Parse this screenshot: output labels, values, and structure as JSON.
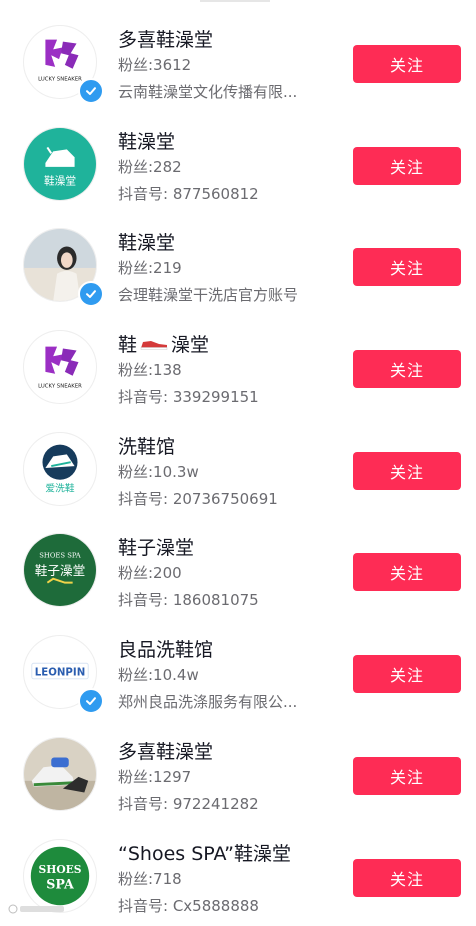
{
  "accounts": [
    {
      "name": "多喜鞋澡堂",
      "fans": "粉丝:3612",
      "sub": "云南鞋澡堂文化传播有限...",
      "verified": true,
      "avatar_text": "LUCKY SNEAKER",
      "follow": "关注"
    },
    {
      "name": "鞋澡堂",
      "fans": "粉丝:282",
      "sub": "抖音号: 877560812",
      "verified": false,
      "avatar_text": "鞋澡堂",
      "follow": "关注"
    },
    {
      "name": "鞋澡堂",
      "fans": "粉丝:219",
      "sub": "会理鞋澡堂干洗店官方账号",
      "verified": true,
      "avatar_text": "",
      "follow": "关注"
    },
    {
      "name_a": "鞋",
      "name_b": "澡堂",
      "fans": "粉丝:138",
      "sub": "抖音号: 339299151",
      "verified": false,
      "avatar_text": "LUCKY SNEAKER",
      "follow": "关注"
    },
    {
      "name": "洗鞋馆",
      "fans": "粉丝:10.3w",
      "sub": "抖音号: 20736750691",
      "verified": false,
      "avatar_text": "爱洗鞋",
      "follow": "关注"
    },
    {
      "name": "鞋子澡堂",
      "fans": "粉丝:200",
      "sub": "抖音号: 186081075",
      "verified": false,
      "avatar_text": "SHOES SPA",
      "avatar_text2": "鞋子澡堂",
      "follow": "关注"
    },
    {
      "name": "良品洗鞋馆",
      "fans": "粉丝:10.4w",
      "sub": "郑州良品洗涤服务有限公...",
      "verified": true,
      "avatar_text": "LEONPIN",
      "follow": "关注"
    },
    {
      "name": "多喜鞋澡堂",
      "fans": "粉丝:1297",
      "sub": "抖音号: 972241282",
      "verified": false,
      "avatar_text": "",
      "follow": "关注"
    },
    {
      "name": "“Shoes SPA”鞋澡堂",
      "fans": "粉丝:718",
      "sub": "抖音号: Cx5888888",
      "verified": false,
      "avatar_text": "SHOES",
      "avatar_text2": "SPA",
      "follow": "关注"
    }
  ],
  "colors": {
    "follow_bg": "#fe2c55",
    "verified": "#2f9bf0"
  }
}
